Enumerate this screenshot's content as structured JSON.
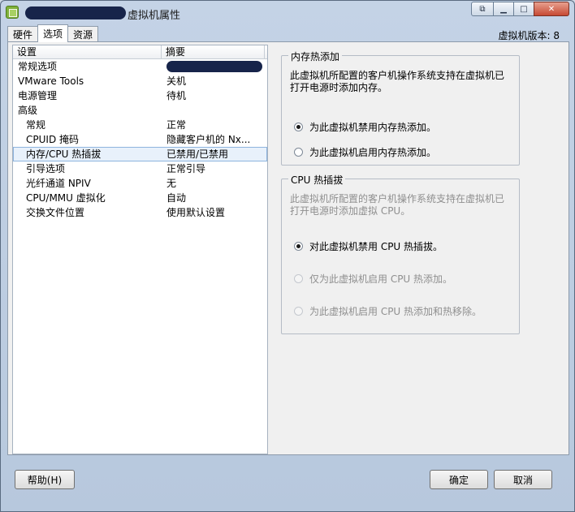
{
  "window": {
    "title_suffix": "虚拟机属性",
    "version_label": "虚拟机版本: 8"
  },
  "tabs": [
    "硬件",
    "选项",
    "资源"
  ],
  "list": {
    "columns": [
      "设置",
      "摘要"
    ],
    "rows": [
      {
        "key": "常规选项",
        "value": ""
      },
      {
        "key": "VMware Tools",
        "value": "关机"
      },
      {
        "key": "电源管理",
        "value": "待机"
      },
      {
        "key": "高级",
        "value": ""
      },
      {
        "key": "常规",
        "value": "正常"
      },
      {
        "key": "CPUID 掩码",
        "value": "隐藏客户机的 Nx..."
      },
      {
        "key": "内存/CPU 热插拔",
        "value": "已禁用/已禁用"
      },
      {
        "key": "引导选项",
        "value": "正常引导"
      },
      {
        "key": "光纤通道 NPIV",
        "value": "无"
      },
      {
        "key": "CPU/MMU 虚拟化",
        "value": "自动"
      },
      {
        "key": "交换文件位置",
        "value": "使用默认设置"
      }
    ]
  },
  "memory_hotadd": {
    "title": "内存热添加",
    "desc": "此虚拟机所配置的客户机操作系统支持在虚拟机已打开电源时添加内存。",
    "options": [
      "为此虚拟机禁用内存热添加。",
      "为此虚拟机启用内存热添加。"
    ],
    "selected": 0
  },
  "cpu_hotplug": {
    "title": "CPU 热插拔",
    "desc": "此虚拟机所配置的客户机操作系统支持在虚拟机已打开电源时添加虚拟 CPU。",
    "options": [
      "对此虚拟机禁用 CPU 热插拔。",
      "仅为此虚拟机启用 CPU 热添加。",
      "为此虚拟机启用 CPU 热添加和热移除。"
    ],
    "selected": 0
  },
  "buttons": {
    "help": "帮助(H)",
    "ok": "确定",
    "cancel": "取消"
  }
}
